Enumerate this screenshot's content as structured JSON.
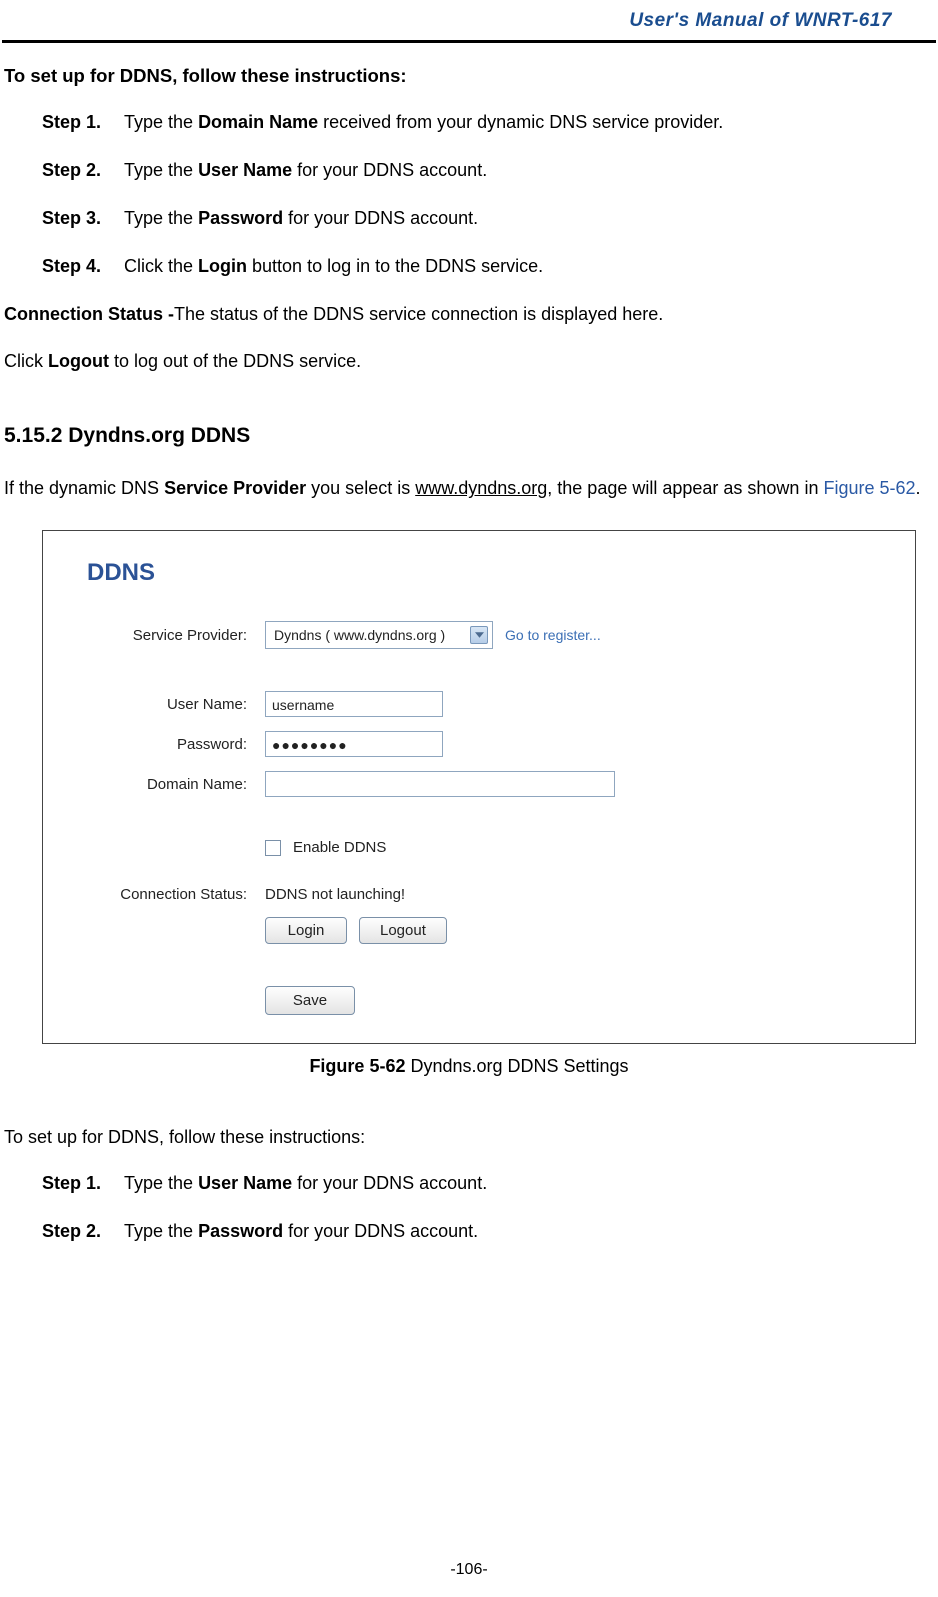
{
  "header": {
    "title": "User's Manual of WNRT-617"
  },
  "section1": {
    "intro": "To set up for DDNS, follow these instructions:",
    "steps": [
      {
        "label": "Step 1.",
        "pre": "Type the ",
        "bold": "Domain Name",
        "post": " received from your dynamic DNS service provider."
      },
      {
        "label": "Step 2.",
        "pre": "Type the ",
        "bold": "User Name",
        "post": " for your DDNS account."
      },
      {
        "label": "Step 3.",
        "pre": "Type the ",
        "bold": "Password",
        "post": " for your DDNS account."
      },
      {
        "label": "Step 4.",
        "pre": "Click the ",
        "bold": "Login",
        "post": " button to log in to the DDNS service."
      }
    ],
    "conn_status_label": "Connection Status -",
    "conn_status_text": "The status of the DDNS service connection is displayed here.",
    "logout_pre": "Click ",
    "logout_bold": "Logout",
    "logout_post": " to log out of the DDNS service."
  },
  "section2": {
    "heading_num": "5.15.2",
    "heading_text": " Dyndns.org DDNS",
    "para_pre": "If the dynamic DNS ",
    "para_bold": "Service Provider",
    "para_mid": " you select is ",
    "para_link": "www.dyndns.org",
    "para_post": ", the page will appear as shown in ",
    "para_figref": "Figure 5-62",
    "para_end": "."
  },
  "figure": {
    "panel_title": "DDNS",
    "labels": {
      "provider": "Service Provider:",
      "username": "User Name:",
      "password": "Password:",
      "domain": "Domain Name:",
      "enable": "Enable DDNS",
      "conn_status": "Connection Status:"
    },
    "values": {
      "provider_selected": "Dyndns ( www.dyndns.org )",
      "register_link": "Go to register...",
      "username": "username",
      "password": "●●●●●●●●",
      "domain": "",
      "status": "DDNS not launching!"
    },
    "buttons": {
      "login": "Login",
      "logout": "Logout",
      "save": "Save"
    },
    "caption_bold": "Figure 5-62",
    "caption_text": "    Dyndns.org DDNS Settings"
  },
  "section3": {
    "intro": "To set up for DDNS, follow these instructions:",
    "steps": [
      {
        "label": "Step 1.",
        "pre": "Type the ",
        "bold": "User Name",
        "post": " for your DDNS account."
      },
      {
        "label": "Step 2.",
        "pre": "Type the ",
        "bold": "Password",
        "post": " for your DDNS account."
      }
    ]
  },
  "footer": {
    "page": "-106-"
  }
}
